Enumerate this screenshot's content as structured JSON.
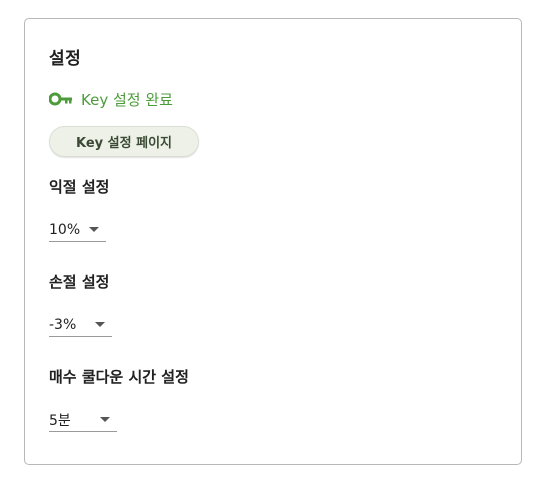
{
  "settings": {
    "title": "설정",
    "key_status": {
      "icon": "key-icon",
      "text": "Key 설정 완료",
      "color": "#4d9c3c"
    },
    "key_page_button_label": "Key 설정 페이지",
    "profit_setting": {
      "label": "익절 설정",
      "selected": "10%"
    },
    "loss_setting": {
      "label": "손절 설정",
      "selected": "-3%"
    },
    "cooldown_setting": {
      "label": "매수 쿨다운 시간 설정",
      "selected": "5분"
    }
  }
}
